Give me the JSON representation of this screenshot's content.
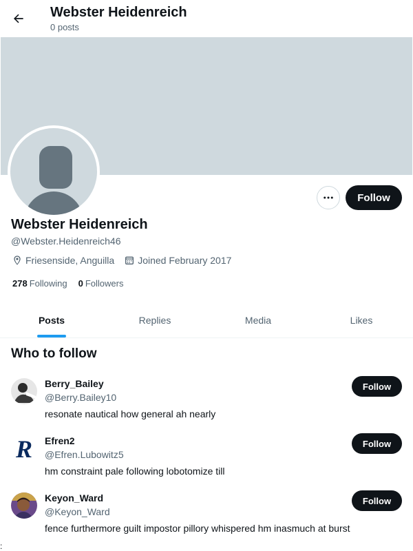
{
  "header": {
    "title": "Webster Heidenreich",
    "post_count": "0 posts",
    "back_icon": "arrow-left-icon"
  },
  "colors": {
    "banner": "#cfd9de",
    "primary_button": "#0f1419",
    "accent": "#1d9bf0",
    "secondary_text": "#536471"
  },
  "profile": {
    "name": "Webster Heidenreich",
    "handle": "@Webster.Heidenreich46",
    "location": "Friesenside, Anguilla",
    "joined": "Joined February 2017",
    "following_count": "278",
    "following_label": "Following",
    "followers_count": "0",
    "followers_label": "Followers",
    "follow_label": "Follow",
    "more_icon": "more-horizontal-icon"
  },
  "tabs": [
    {
      "label": "Posts",
      "active": true
    },
    {
      "label": "Replies",
      "active": false
    },
    {
      "label": "Media",
      "active": false
    },
    {
      "label": "Likes",
      "active": false
    }
  ],
  "who_to_follow": {
    "title": "Who to follow",
    "users": [
      {
        "name": "Berry_Bailey",
        "handle": "@Berry.Bailey10",
        "bio": "resonate nautical how general ah nearly",
        "follow_label": "Follow"
      },
      {
        "name": "Efren2",
        "handle": "@Efren.Lubowitz5",
        "bio": "hm constraint pale following lobotomize till",
        "follow_label": "Follow"
      },
      {
        "name": "Keyon_Ward",
        "handle": "@Keyon_Ward",
        "bio": "fence furthermore guilt impostor pillory whispered hm inasmuch at burst",
        "follow_label": "Follow"
      }
    ]
  },
  "stray_mark": ":"
}
